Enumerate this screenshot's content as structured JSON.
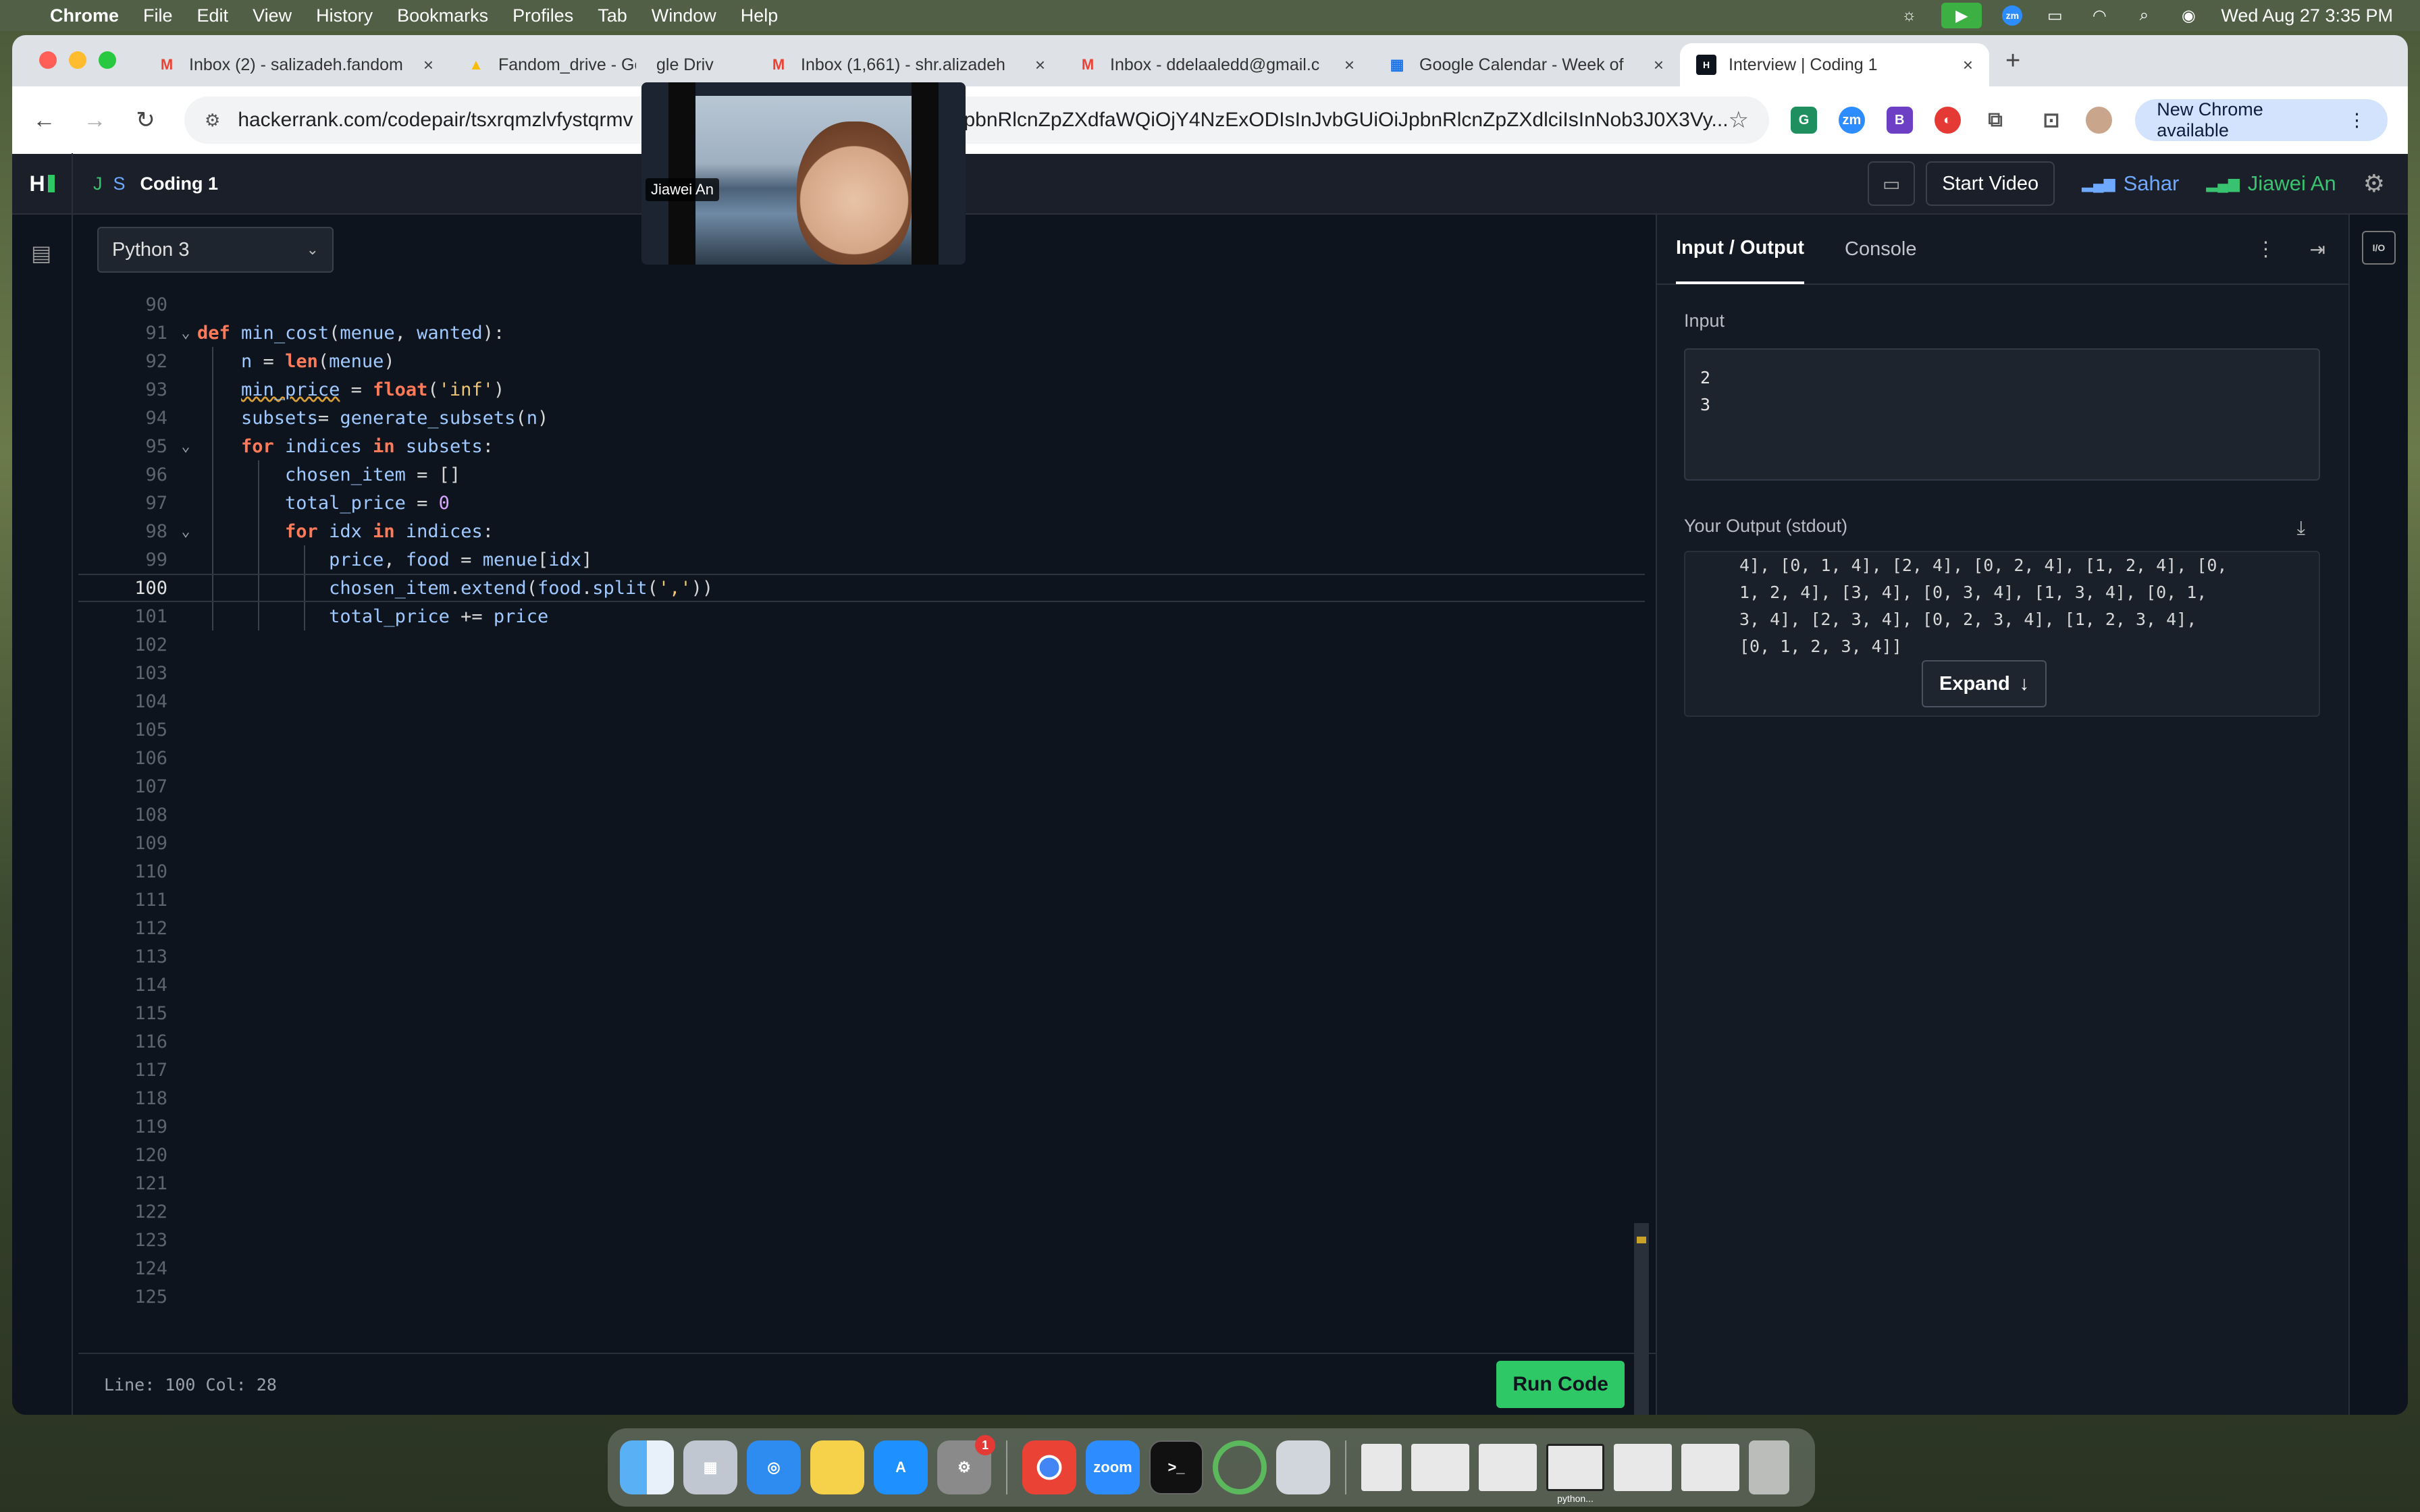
{
  "menubar": {
    "app": "Chrome",
    "items": [
      "File",
      "Edit",
      "View",
      "History",
      "Bookmarks",
      "Profiles",
      "Tab",
      "Window",
      "Help"
    ],
    "clock": "Wed Aug 27  3:35 PM"
  },
  "tabs": [
    {
      "label": "Inbox (2) - salizadeh.fandom",
      "icon": "gmail-icon"
    },
    {
      "label": "Fandom_drive - Go",
      "icon": "google-drive-icon"
    },
    {
      "label": "gle Driv",
      "icon": "google-drive-icon"
    },
    {
      "label": "Inbox (1,661) - shr.alizadeh",
      "icon": "gmail-icon"
    },
    {
      "label": "Inbox - ddelaaledd@gmail.c",
      "icon": "gmail-icon"
    },
    {
      "label": "Google Calendar - Week of",
      "icon": "calendar-icon"
    },
    {
      "label": "Interview | Coding 1",
      "icon": "hackerrank-icon"
    }
  ],
  "omnibox": {
    "url_left": "hackerrank.com/codepair/tsxrqmzlvfystqrmv",
    "url_right": "pbnRlcnZpZXdfaWQiOjY4NzExODIsInJvbGUiOiJpbnRlcnZpZXdlciIsInNob3J0X3Vy..."
  },
  "new_chrome": "New Chrome available",
  "header": {
    "crumb_j": "J",
    "crumb_s": "S",
    "title": "Coding 1",
    "start_video": "Start Video",
    "participants": [
      {
        "name": "Sahar",
        "color": "#6ea8ff"
      },
      {
        "name": "Jiawei An",
        "color": "#39c26f"
      }
    ]
  },
  "editor": {
    "language": "Python 3",
    "status": "Line: 100 Col: 28",
    "run_label": "Run Code",
    "current_line": 100,
    "lines": [
      {
        "n": "90",
        "t": ""
      },
      {
        "n": "91",
        "t": "def min_cost(menue, wanted):"
      },
      {
        "n": "92",
        "t": "    n = len(menue)"
      },
      {
        "n": "93",
        "t": "    min_price = float('inf')"
      },
      {
        "n": "94",
        "t": "    subsets= generate_subsets(n)"
      },
      {
        "n": "95",
        "t": "    for indices in subsets:"
      },
      {
        "n": "96",
        "t": "        chosen_item = []"
      },
      {
        "n": "97",
        "t": "        total_price = 0"
      },
      {
        "n": "98",
        "t": "        for idx in indices:"
      },
      {
        "n": "99",
        "t": "            price, food = menue[idx]"
      },
      {
        "n": "100",
        "t": "            chosen_item.extend(food.split(','))"
      },
      {
        "n": "101",
        "t": "            total_price += price"
      },
      {
        "n": "102",
        "t": ""
      },
      {
        "n": "103",
        "t": ""
      },
      {
        "n": "104",
        "t": ""
      },
      {
        "n": "105",
        "t": ""
      },
      {
        "n": "106",
        "t": ""
      },
      {
        "n": "107",
        "t": ""
      },
      {
        "n": "108",
        "t": ""
      },
      {
        "n": "109",
        "t": ""
      },
      {
        "n": "110",
        "t": ""
      },
      {
        "n": "111",
        "t": ""
      },
      {
        "n": "112",
        "t": ""
      },
      {
        "n": "113",
        "t": ""
      },
      {
        "n": "114",
        "t": ""
      },
      {
        "n": "115",
        "t": ""
      },
      {
        "n": "116",
        "t": ""
      },
      {
        "n": "117",
        "t": ""
      },
      {
        "n": "118",
        "t": ""
      },
      {
        "n": "119",
        "t": ""
      },
      {
        "n": "120",
        "t": ""
      },
      {
        "n": "121",
        "t": ""
      },
      {
        "n": "122",
        "t": ""
      },
      {
        "n": "123",
        "t": ""
      },
      {
        "n": "124",
        "t": ""
      },
      {
        "n": "125",
        "t": ""
      }
    ]
  },
  "io": {
    "tab_io": "Input / Output",
    "tab_console": "Console",
    "input_label": "Input",
    "input_value": "2\n3",
    "output_label": "Your Output (stdout)",
    "output_lines": [
      "4], [0, 1, 4], [2, 4], [0, 2, 4], [1, 2, 4], [0,",
      "1, 2, 4], [3, 4], [0, 3, 4], [1, 3, 4], [0, 1,",
      "3, 4], [2, 3, 4], [0, 2, 3, 4], [1, 2, 3, 4],",
      "[0, 1, 2, 3, 4]]"
    ],
    "expand_label": "Expand"
  },
  "video": {
    "name": "Jiawei An"
  },
  "dock": {
    "zoom_label": "zoom",
    "settings_badge": "1",
    "thumb_caption": "python..."
  }
}
